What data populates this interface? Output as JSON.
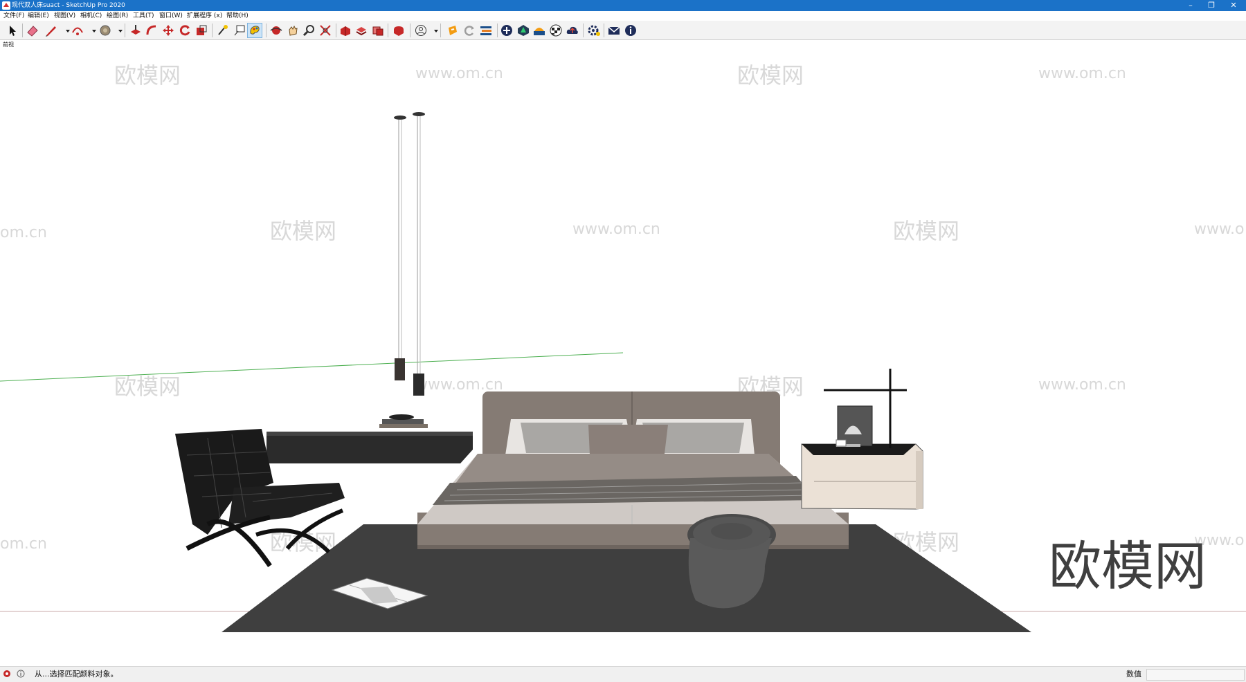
{
  "window": {
    "title": "现代双人床suact - SketchUp Pro 2020",
    "controls": {
      "minimize": "–",
      "restore": "❐",
      "close": "✕"
    }
  },
  "menu": [
    "文件(F)",
    "编辑(E)",
    "视图(V)",
    "相机(C)",
    "绘图(R)",
    "工具(T)",
    "窗口(W)",
    "扩展程序 (x)",
    "帮助(H)"
  ],
  "toolbar": {
    "tools": [
      {
        "icon": "select-arrow-icon"
      },
      {
        "icon": "eraser-icon"
      },
      {
        "icon": "pencil-line-icon"
      },
      {
        "icon": "arc-icon"
      },
      {
        "icon": "paint-bucket-icon"
      },
      {
        "icon": "push-pull-icon"
      },
      {
        "icon": "follow-me-icon"
      },
      {
        "icon": "move-icon"
      },
      {
        "icon": "rotate-icon"
      },
      {
        "icon": "scale-icon"
      },
      {
        "icon": "tape-measure-icon"
      },
      {
        "icon": "text-icon"
      },
      {
        "icon": "paint-icon",
        "active": true
      },
      {
        "icon": "orbit-icon"
      },
      {
        "icon": "pan-icon"
      },
      {
        "icon": "zoom-icon"
      },
      {
        "icon": "zoom-extents-icon"
      },
      {
        "icon": "warehouse-icon"
      },
      {
        "icon": "share-model-icon"
      },
      {
        "icon": "components-icon"
      },
      {
        "icon": "extension-warehouse-icon"
      },
      {
        "icon": "account-icon"
      },
      {
        "icon": "plugin-orange-icon"
      },
      {
        "icon": "refresh-icon"
      },
      {
        "icon": "layers-icon"
      },
      {
        "icon": "add-circle-icon"
      },
      {
        "icon": "tree-icon"
      },
      {
        "icon": "sunset-icon"
      },
      {
        "icon": "checker-ball-icon"
      },
      {
        "icon": "cloud-upload-icon"
      },
      {
        "icon": "settings-icon"
      },
      {
        "icon": "mail-icon"
      },
      {
        "icon": "info-icon"
      }
    ]
  },
  "viewport": {
    "scene_tab": "前视",
    "watermark_small": [
      "欧模网",
      "www.om.cn",
      "om.cn",
      "www.o"
    ],
    "watermark_large": "欧模网"
  },
  "status": {
    "hint": "从...选择匹配颜料对象。",
    "measurements_label": "数值",
    "measurements_value": ""
  }
}
